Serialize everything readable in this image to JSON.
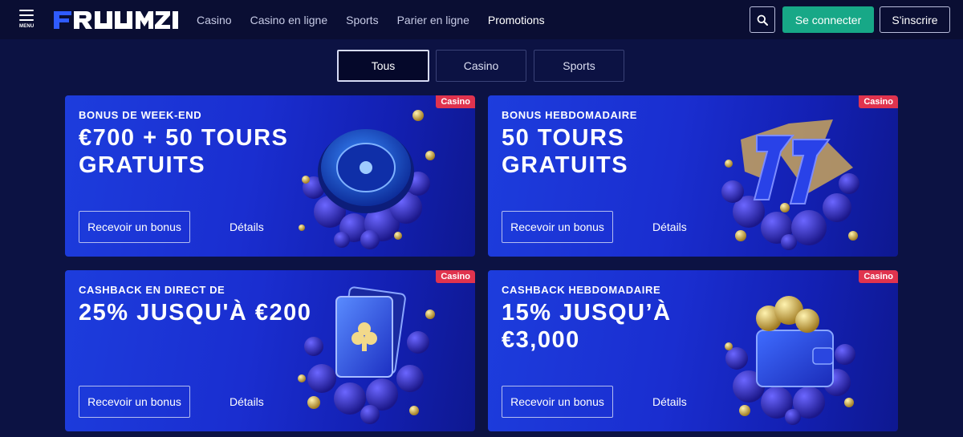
{
  "header": {
    "menu_label": "MENU",
    "logo_text": "FRUMZI",
    "nav": [
      {
        "label": "Casino"
      },
      {
        "label": "Casino en ligne"
      },
      {
        "label": "Sports"
      },
      {
        "label": "Parier en ligne"
      },
      {
        "label": "Promotions",
        "active": true
      }
    ],
    "search_icon": "search-icon",
    "login_label": "Se connecter",
    "signup_label": "S'inscrire"
  },
  "tabs": [
    {
      "label": "Tous",
      "active": true
    },
    {
      "label": "Casino"
    },
    {
      "label": "Sports"
    }
  ],
  "cards": [
    {
      "badge": "Casino",
      "subtitle": "BONUS DE WEEK-END",
      "headline_lines": [
        "€700 + 50 TOURS",
        "GRATUITS"
      ],
      "cta": "Recevoir un bonus",
      "details": "Détails",
      "art": "roulette-wheel"
    },
    {
      "badge": "Casino",
      "subtitle": "BONUS HEBDOMADAIRE",
      "headline_lines": [
        "50 TOURS",
        "GRATUITS"
      ],
      "cta": "Recevoir un bonus",
      "details": "Détails",
      "art": "lucky-sevens"
    },
    {
      "badge": "Casino",
      "subtitle": "CASHBACK EN DIRECT DE",
      "headline_lines": [
        "25% JUSQU'À €200"
      ],
      "cta": "Recevoir un bonus",
      "details": "Détails",
      "art": "playing-cards"
    },
    {
      "badge": "Casino",
      "subtitle": "CASHBACK HEBDOMADAIRE",
      "headline_lines": [
        "15% JUSQU’À",
        "€3,000"
      ],
      "cta": "Recevoir un bonus",
      "details": "Détails",
      "art": "wallet-coins"
    }
  ],
  "colors": {
    "background": "#0c1243",
    "header_bg": "#0a0e33",
    "primary_button": "#17a887",
    "badge": "#e0334e",
    "card_gradient_start": "#1d3ddd",
    "card_gradient_end": "#0e1890"
  }
}
